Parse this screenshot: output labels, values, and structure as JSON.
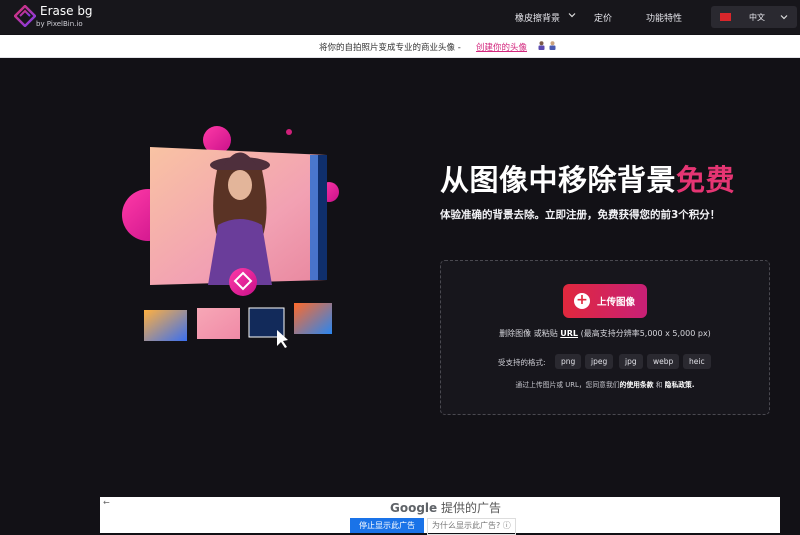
{
  "nav": {
    "logo_title": "Erase bg",
    "logo_subtitle": "by PixelBin.io",
    "items": [
      {
        "label": "橡皮擦背景"
      },
      {
        "label": "定价"
      },
      {
        "label": "功能特性"
      }
    ],
    "language": "中文"
  },
  "banner": {
    "text": "将你的自拍照片变成专业的商业头像 -",
    "link": "创建你的头像"
  },
  "hero": {
    "title_main": "从图像中移除背景",
    "title_accent": "免费",
    "subtitle": "体验准确的背景去除。立即注册，免费获得您的前3个积分！"
  },
  "upload": {
    "button_label": "上传图像",
    "hint_prefix": "删除图像 或粘贴",
    "hint_url": "URL",
    "hint_suffix": "(最高支持分辨率5,000 x 5,000 px)",
    "formats_label": "受支持的格式:",
    "formats": [
      "png",
      "jpeg",
      "jpg",
      "webp",
      "heic"
    ],
    "terms_prefix": "通过上传图片或 URL，您同意我们",
    "terms_link1": "的使用条款",
    "terms_mid": "和",
    "terms_link2": "隐私政策."
  },
  "ad": {
    "back_arrow": "←",
    "google": "Google",
    "provided": "提供的广告",
    "stop_label": "停止显示此广告",
    "why_label": "为什么显示此广告?"
  },
  "colors": {
    "accent": "#e53573",
    "button_start": "#e0283d",
    "button_end": "#c82076"
  }
}
